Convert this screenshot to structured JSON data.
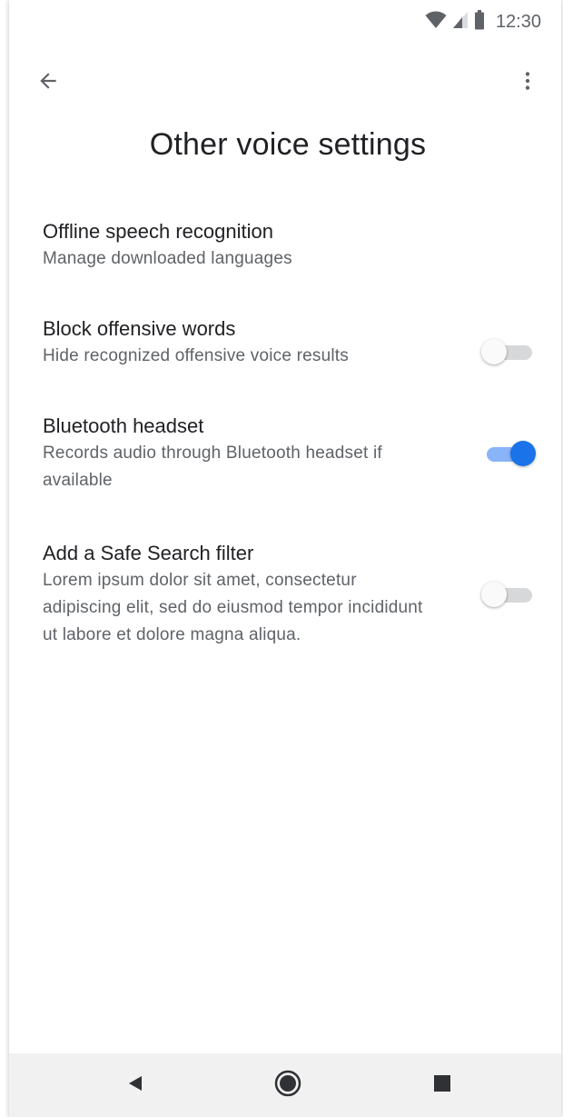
{
  "status_bar": {
    "time": "12:30",
    "icons": [
      "wifi-icon",
      "cell-signal-icon",
      "battery-icon"
    ]
  },
  "app_bar": {
    "back_icon": "arrow-back-icon",
    "more_icon": "more-vert-icon"
  },
  "page": {
    "title": "Other voice settings"
  },
  "settings": [
    {
      "title": "Offline speech recognition",
      "description": "Manage downloaded languages",
      "has_toggle": false
    },
    {
      "title": "Block offensive words",
      "description": "Hide recognized offensive voice results",
      "has_toggle": true,
      "toggle_on": false
    },
    {
      "title": "Bluetooth headset",
      "description": "Records audio through Bluetooth headset if available",
      "has_toggle": true,
      "toggle_on": true
    },
    {
      "title": "Add a Safe Search filter",
      "description": "Lorem ipsum dolor sit amet, consectetur adipiscing elit, sed do eiusmod tempor incididunt ut labore et dolore magna aliqua.",
      "has_toggle": true,
      "toggle_on": false
    }
  ],
  "nav_bar": {
    "back_icon": "nav-back-icon",
    "home_icon": "nav-home-icon",
    "recents_icon": "nav-recents-icon"
  },
  "colors": {
    "accent": "#1a73e8",
    "accent_track": "#8ab4f8",
    "primary_text": "#202124",
    "secondary_text": "#5f6368",
    "nav_bar_bg": "#f1f1f1"
  }
}
